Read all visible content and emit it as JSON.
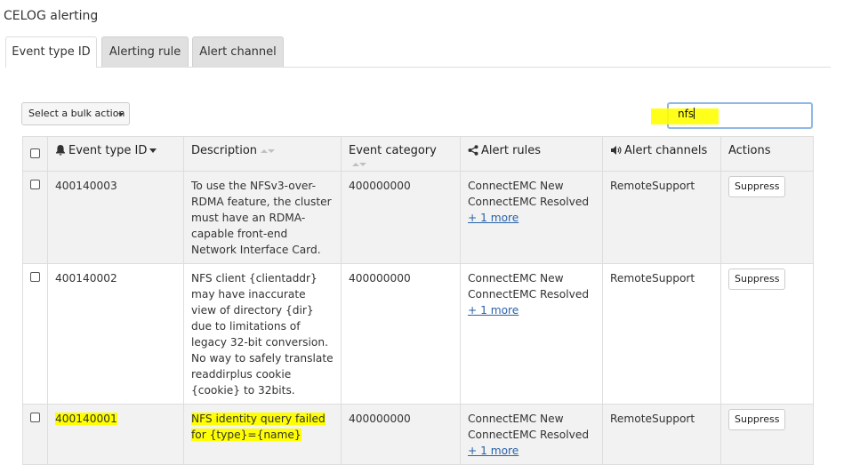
{
  "page_title": "CELOG alerting",
  "tabs": [
    {
      "label": "Event type ID",
      "active": true
    },
    {
      "label": "Alerting rule",
      "active": false
    },
    {
      "label": "Alert channel",
      "active": false
    }
  ],
  "bulk_action": {
    "label": "Select a bulk action"
  },
  "search": {
    "value": "nfs"
  },
  "table": {
    "headers": {
      "event_type_id": "Event type ID",
      "description": "Description",
      "event_category": "Event category",
      "alert_rules": "Alert rules",
      "alert_channels": "Alert channels",
      "actions": "Actions"
    },
    "rows": [
      {
        "id": "400140003",
        "description": "To use the NFSv3-over-RDMA feature, the cluster must have an RDMA-capable front-end Network Interface Card.",
        "category": "400000000",
        "rule1": "ConnectEMC New",
        "rule2": "ConnectEMC Resolved",
        "more": "+ 1 more",
        "channel": "RemoteSupport",
        "action": "Suppress"
      },
      {
        "id": "400140002",
        "description": "NFS client {clientaddr} may have inaccurate view of directory {dir} due to limitations of legacy 32-bit conversion. No way to safely translate readdirplus cookie {cookie} to 32bits.",
        "category": "400000000",
        "rule1": "ConnectEMC New",
        "rule2": "ConnectEMC Resolved",
        "more": "+ 1 more",
        "channel": "RemoteSupport",
        "action": "Suppress"
      },
      {
        "id": "400140001",
        "description_line1": "NFS identity query failed",
        "description_line2": "for {type}={name}",
        "category": "400000000",
        "rule1": "ConnectEMC New",
        "rule2": "ConnectEMC Resolved",
        "more": "+ 1 more",
        "channel": "RemoteSupport",
        "action": "Suppress"
      }
    ]
  },
  "colors": {
    "highlight": "#ffff00",
    "link": "#2a62a8",
    "header_bg": "#f2f2f2"
  }
}
